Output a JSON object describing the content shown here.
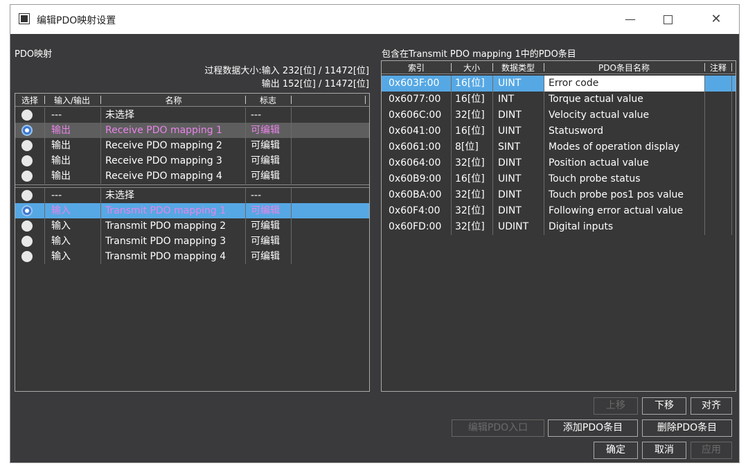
{
  "window": {
    "title": "编辑PDO映射设置",
    "minimize": "—",
    "close": "✕"
  },
  "left": {
    "title": "PDO映射",
    "process_label": "过程数据大小:输入",
    "input_size": "232[位] / 11472[位]",
    "output_label": "输出",
    "output_size": "152[位] / 11472[位]",
    "columns": [
      "选择",
      "输入/输出",
      "名称",
      "标志"
    ],
    "rows": [
      {
        "io": "---",
        "name": "未选择",
        "flag": "---",
        "selected": false
      },
      {
        "io": "输出",
        "name": "Receive PDO mapping 1",
        "flag": "可编辑",
        "selected": true
      },
      {
        "io": "输出",
        "name": "Receive PDO mapping 2",
        "flag": "可编辑",
        "selected": false
      },
      {
        "io": "输出",
        "name": "Receive PDO mapping 3",
        "flag": "可编辑",
        "selected": false
      },
      {
        "io": "输出",
        "name": "Receive PDO mapping 4",
        "flag": "可编辑",
        "selected": false
      },
      {
        "io": "---",
        "name": "未选择",
        "flag": "---",
        "selected": false
      },
      {
        "io": "输入",
        "name": "Transmit PDO mapping 1",
        "flag": "可编辑",
        "selected": true
      },
      {
        "io": "输入",
        "name": "Transmit PDO mapping 2",
        "flag": "可编辑",
        "selected": false
      },
      {
        "io": "输入",
        "name": "Transmit PDO mapping 3",
        "flag": "可编辑",
        "selected": false
      },
      {
        "io": "输入",
        "name": "Transmit PDO mapping 4",
        "flag": "可编辑",
        "selected": false
      }
    ]
  },
  "right": {
    "title": "包含在Transmit PDO mapping 1中的PDO条目",
    "columns": [
      "索引",
      "大小",
      "数据类型",
      "PDO条目名称",
      "注释"
    ],
    "rows": [
      {
        "index": "0x603F:00",
        "size": "16[位]",
        "type": "UINT",
        "name": "Error code"
      },
      {
        "index": "0x6077:00",
        "size": "16[位]",
        "type": "INT",
        "name": "Torque actual value"
      },
      {
        "index": "0x606C:00",
        "size": "32[位]",
        "type": "DINT",
        "name": "Velocity actual value"
      },
      {
        "index": "0x6041:00",
        "size": "16[位]",
        "type": "UINT",
        "name": "Statusword"
      },
      {
        "index": "0x6061:00",
        "size": "8[位]",
        "type": "SINT",
        "name": "Modes of operation display"
      },
      {
        "index": "0x6064:00",
        "size": "32[位]",
        "type": "DINT",
        "name": "Position actual value"
      },
      {
        "index": "0x60B9:00",
        "size": "16[位]",
        "type": "UINT",
        "name": "Touch probe status"
      },
      {
        "index": "0x60BA:00",
        "size": "32[位]",
        "type": "DINT",
        "name": "Touch probe pos1 pos value"
      },
      {
        "index": "0x60F4:00",
        "size": "32[位]",
        "type": "DINT",
        "name": "Following error actual value"
      },
      {
        "index": "0x60FD:00",
        "size": "32[位]",
        "type": "UDINT",
        "name": "Digital inputs"
      }
    ]
  },
  "buttons": {
    "move_up": "上移",
    "move_down": "下移",
    "align": "对齐",
    "edit_entry": "编辑PDO入口",
    "add_entry": "添加PDO条目",
    "delete_entry": "删除PDO条目",
    "ok": "确定",
    "cancel": "取消",
    "apply": "应用"
  },
  "colors": {
    "selection_blue": "#56a8e4",
    "selected_text": "#e884e8",
    "panel_bg": "#3a3a3c"
  }
}
